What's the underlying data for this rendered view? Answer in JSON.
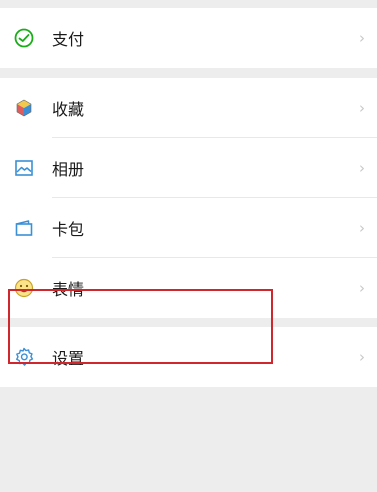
{
  "menu": {
    "pay": {
      "label": "支付",
      "icon": "wechat-pay-icon"
    },
    "favorites": {
      "label": "收藏",
      "icon": "favorites-cube-icon"
    },
    "album": {
      "label": "相册",
      "icon": "photo-album-icon"
    },
    "cards": {
      "label": "卡包",
      "icon": "card-wallet-icon"
    },
    "stickers": {
      "label": "表情",
      "icon": "smiley-icon"
    },
    "settings": {
      "label": "设置",
      "icon": "gear-icon"
    }
  },
  "chevron": "›",
  "colors": {
    "highlight_border": "#d0272f",
    "background": "#ededed",
    "accent_green": "#1aad19",
    "icon_blue": "#3b8fd6"
  }
}
